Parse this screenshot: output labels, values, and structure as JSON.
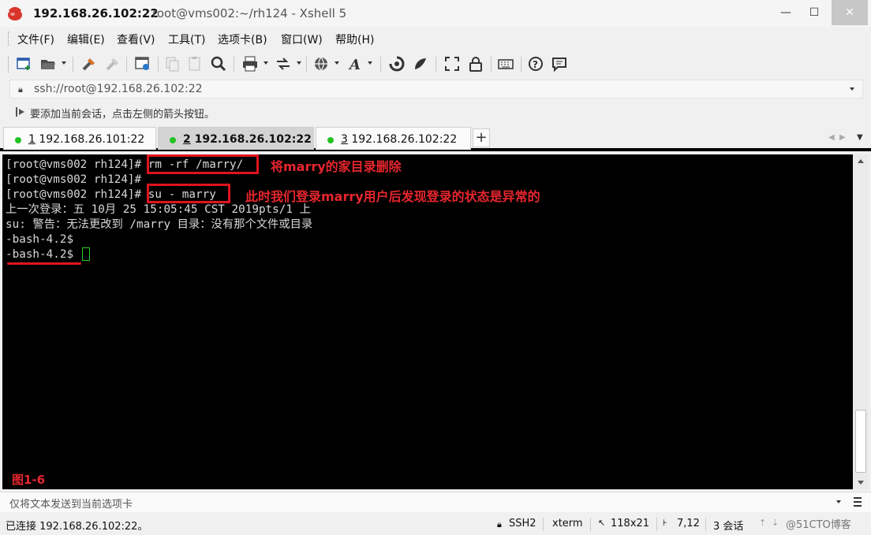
{
  "window": {
    "title_host": "192.168.26.102:22",
    "title_rest": "root@vms002:~/rh124 - Xshell 5",
    "controls": [
      "—",
      "☐",
      "✕"
    ]
  },
  "menu": [
    "文件(F)",
    "编辑(E)",
    "查看(V)",
    "工具(T)",
    "选项卡(B)",
    "窗口(W)",
    "帮助(H)"
  ],
  "address": {
    "value": "ssh://root@192.168.26.102:22"
  },
  "hint": "要添加当前会话，点击左侧的箭头按钮。",
  "tabs": [
    {
      "num": "1",
      "label": " 192.168.26.101:22"
    },
    {
      "num": "2",
      "label": " 192.168.26.102:22"
    },
    {
      "num": "3",
      "label": " 192.168.26.102:22"
    }
  ],
  "tab_add": "+",
  "terminal": {
    "lines": [
      "[root@vms002 rh124]# rm -rf /marry/",
      "[root@vms002 rh124]#",
      "[root@vms002 rh124]# su - marry",
      "上一次登录：五 10月 25 15:05:45 CST 2019pts/1 上",
      "su: 警告：无法更改到 /marry 目录：没有那个文件或目录",
      "-bash-4.2$",
      "-bash-4.2$ "
    ],
    "annotations": [
      "将marry的家目录删除",
      "此时我们登录marry用户后发现登录的状态是异常的"
    ],
    "figure_label": "图1-6"
  },
  "send_bar": "仅将文本发送到当前选项卡",
  "status": {
    "connection": "已连接 192.168.26.102:22。",
    "protocol": "SSH2",
    "terminal_type": "xterm",
    "size": "118x21",
    "cursor_pos": "7,12",
    "sessions": "3 会话",
    "watermark": "@51CTO博客"
  }
}
